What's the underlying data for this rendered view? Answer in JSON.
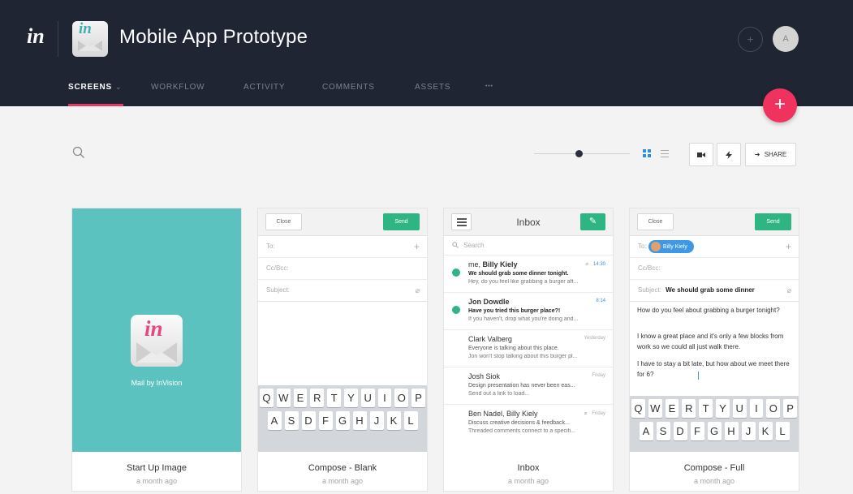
{
  "header": {
    "brand_glyph": "in",
    "app_icon_glyph": "in",
    "title": "Mobile App Prototype",
    "avatar_initial": "A",
    "circle_glyph": "+"
  },
  "tabs": [
    {
      "label": "SCREENS",
      "active": true,
      "caret": "⌄"
    },
    {
      "label": "WORKFLOW"
    },
    {
      "label": "ACTIVITY"
    },
    {
      "label": "COMMENTS"
    },
    {
      "label": "ASSETS"
    },
    {
      "label": "•••"
    }
  ],
  "fab": {
    "glyph": "+"
  },
  "toolbar": {
    "zoom_level": 0.5,
    "view_mode": "grid",
    "video_icon": "video-icon",
    "lightning_icon": "lightning-icon",
    "share_label": "SHARE",
    "share_glyph": "➜"
  },
  "colors": {
    "header_bg": "#1f2532",
    "accent_pink": "#f0335e",
    "teal": "#5bc2bf",
    "send_green": "#2fb583"
  },
  "screens": [
    {
      "name": "Start Up Image",
      "date": "a month ago",
      "splash": {
        "glyph": "in",
        "label": "Mail by InVision"
      }
    },
    {
      "name": "Compose - Blank",
      "date": "a month ago",
      "close": "Close",
      "send": "Send",
      "to": "To:",
      "ccbcc": "Cc/Bcc:",
      "subject": "Subject:",
      "plus": "+",
      "clip": "⌀",
      "kb_row1": [
        "Q",
        "W",
        "E",
        "R",
        "T",
        "Y",
        "U",
        "I",
        "O",
        "P"
      ],
      "kb_row2": [
        "A",
        "S",
        "D",
        "F",
        "G",
        "H",
        "J",
        "K",
        "L"
      ]
    },
    {
      "name": "Inbox",
      "date": "a month ago",
      "title": "Inbox",
      "search": "Search",
      "pencil": "✎",
      "messages": [
        {
          "sender_pre": "me, ",
          "sender": "Billy Kiely",
          "subject": "We should grab some dinner tonight.",
          "preview": "Hey, do you feel like grabbing a burger aft...",
          "time": "14:30",
          "unread": true,
          "clip": "⌀"
        },
        {
          "sender": "Jon Dowdle",
          "subject": "Have you tried this burger place?!",
          "preview": "If you haven't, drop what you're doing and...",
          "time": "8:14",
          "unread": true
        },
        {
          "sender": "Clark Valberg",
          "subject": "Everyone is talking about this place.",
          "preview": "Jon won't stop talking about this burger pl...",
          "time": "Yesterday",
          "unread": false
        },
        {
          "sender": "Josh Siok",
          "subject": "Design presentation has never been eas...",
          "preview": "Send out a link to load...",
          "time": "Friday",
          "unread": false
        },
        {
          "sender": "Ben Nadel, Billy Kiely",
          "subject": "Discuss creative decisions & feedback...",
          "preview": "Threaded comments connect to a specifi...",
          "time": "Friday",
          "unread": false,
          "clip": "⌀"
        }
      ]
    },
    {
      "name": "Compose - Full",
      "date": "a month ago",
      "close": "Close",
      "send": "Send",
      "to": "To:",
      "to_name": "Billy Kiely",
      "ccbcc": "Cc/Bcc:",
      "subject_label": "Subject:",
      "subject_value": "We should grab some dinner",
      "plus": "+",
      "clip": "⌀",
      "body": [
        "How do you feel about grabbing a burger tonight?",
        "I know a great place and it's only a few blocks from work so we could all just walk there.",
        "I have to stay a bit late, but how about we meet there for 6?"
      ],
      "kb_row1": [
        "Q",
        "W",
        "E",
        "R",
        "T",
        "Y",
        "U",
        "I",
        "O",
        "P"
      ],
      "kb_row2": [
        "A",
        "S",
        "D",
        "F",
        "G",
        "H",
        "J",
        "K",
        "L"
      ]
    }
  ]
}
